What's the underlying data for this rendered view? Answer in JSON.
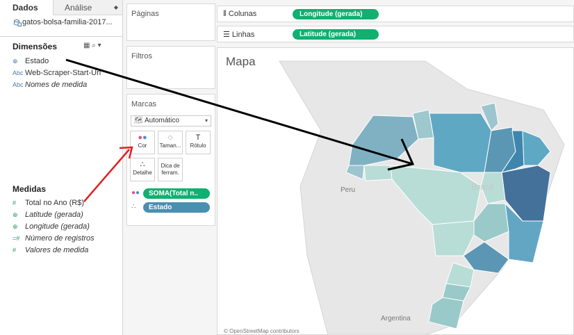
{
  "data_pane": {
    "tabs": [
      "Dados",
      "Análise"
    ],
    "datasource": "gatos-bolsa-familia-2017...",
    "dimensions_title": "Dimensões",
    "dimensions": [
      {
        "icon": "globe-icon",
        "type_label": "⊕",
        "label": "Estado",
        "italic": false
      },
      {
        "icon": "abc-icon",
        "type_label": "Abc",
        "label": "Web-Scraper-Start-Url",
        "italic": false
      },
      {
        "icon": "abc-icon",
        "type_label": "Abc",
        "label": "Nomes de medida",
        "italic": true
      }
    ],
    "measures_title": "Medidas",
    "measures": [
      {
        "icon": "number-icon",
        "type_label": "#",
        "label": "Total no Ano (R$)",
        "italic": false
      },
      {
        "icon": "globe-icon",
        "type_label": "⊕",
        "label": "Latitude (gerada)",
        "italic": true
      },
      {
        "icon": "globe-icon",
        "type_label": "⊕",
        "label": "Longitude (gerada)",
        "italic": true
      },
      {
        "icon": "number-icon",
        "type_label": "=#",
        "label": "Número de registros",
        "italic": true
      },
      {
        "icon": "number-icon",
        "type_label": "#",
        "label": "Valores de medida",
        "italic": true
      }
    ]
  },
  "shelves": {
    "pages": "Páginas",
    "filters": "Filtros",
    "marks": "Marcas",
    "marks_type": "Automático",
    "mark_buttons": {
      "cor": "Cor",
      "tamanho": "Taman...",
      "rotulo": "Rótulo",
      "detalhe": "Detalhe",
      "dica": "Dica de ferram."
    },
    "mark_pills": {
      "soma": "SOMA(Total n..",
      "estado": "Estado"
    },
    "columns_label": "Colunas",
    "columns_pill": "Longitude (gerada)",
    "rows_label": "Linhas",
    "rows_pill": "Latitude (gerada)"
  },
  "view": {
    "title": "Mapa",
    "map_labels": {
      "peru": "Peru",
      "brasil": "Brasil",
      "argentina": "Argentina"
    },
    "attribution": "© OpenStreetMap contributors"
  },
  "colors": {
    "green_pill": "#10b070",
    "blue_pill": "#4a8fb0",
    "annotation_red": "#e02020",
    "annotation_black": "#000000"
  }
}
